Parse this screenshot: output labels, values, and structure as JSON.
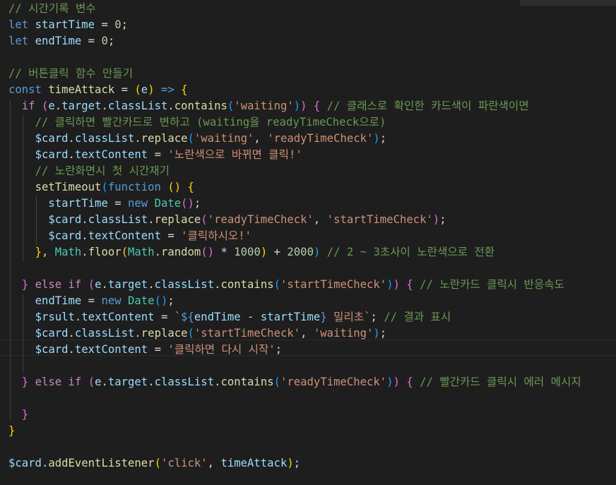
{
  "editor": {
    "theme_colors": {
      "background": "#1e1e1e",
      "comment": "#6a9955",
      "keyword": "#569cd6",
      "control": "#c586c0",
      "variable": "#9cdcfe",
      "function": "#dcdcaa",
      "string": "#ce9178",
      "number": "#b5cea8",
      "class": "#4ec9b0"
    },
    "lines": [
      {
        "tokens": [
          {
            "t": "// 시간기록 변수",
            "c": "comment"
          }
        ]
      },
      {
        "tokens": [
          {
            "t": "let",
            "c": "kw"
          },
          {
            "t": " ",
            "c": "op"
          },
          {
            "t": "startTime",
            "c": "var"
          },
          {
            "t": " = ",
            "c": "op"
          },
          {
            "t": "0",
            "c": "num"
          },
          {
            "t": ";",
            "c": "op"
          }
        ]
      },
      {
        "tokens": [
          {
            "t": "let",
            "c": "kw"
          },
          {
            "t": " ",
            "c": "op"
          },
          {
            "t": "endTime",
            "c": "var"
          },
          {
            "t": " = ",
            "c": "op"
          },
          {
            "t": "0",
            "c": "num"
          },
          {
            "t": ";",
            "c": "op"
          }
        ]
      },
      {
        "tokens": []
      },
      {
        "tokens": [
          {
            "t": "// 버튼클릭 함수 만들기",
            "c": "comment"
          }
        ]
      },
      {
        "tokens": [
          {
            "t": "const",
            "c": "kw"
          },
          {
            "t": " ",
            "c": "op"
          },
          {
            "t": "timeAttack",
            "c": "fn"
          },
          {
            "t": " = ",
            "c": "op"
          },
          {
            "t": "(",
            "c": "b1"
          },
          {
            "t": "e",
            "c": "var"
          },
          {
            "t": ")",
            "c": "b1"
          },
          {
            "t": " ",
            "c": "op"
          },
          {
            "t": "=>",
            "c": "kw"
          },
          {
            "t": " ",
            "c": "op"
          },
          {
            "t": "{",
            "c": "b1"
          }
        ]
      },
      {
        "tokens": [
          {
            "t": "  ",
            "c": "op"
          },
          {
            "t": "if",
            "c": "ctl"
          },
          {
            "t": " ",
            "c": "op"
          },
          {
            "t": "(",
            "c": "b2"
          },
          {
            "t": "e",
            "c": "var"
          },
          {
            "t": ".",
            "c": "op"
          },
          {
            "t": "target",
            "c": "var"
          },
          {
            "t": ".",
            "c": "op"
          },
          {
            "t": "classList",
            "c": "var"
          },
          {
            "t": ".",
            "c": "op"
          },
          {
            "t": "contains",
            "c": "fn"
          },
          {
            "t": "(",
            "c": "b3"
          },
          {
            "t": "'waiting'",
            "c": "str"
          },
          {
            "t": ")",
            "c": "b3"
          },
          {
            "t": ")",
            "c": "b2"
          },
          {
            "t": " ",
            "c": "op"
          },
          {
            "t": "{",
            "c": "b2"
          },
          {
            "t": " ",
            "c": "op"
          },
          {
            "t": "// 클래스로 확인한 카드색이 파란색이면",
            "c": "comment"
          }
        ]
      },
      {
        "tokens": [
          {
            "t": "    ",
            "c": "op"
          },
          {
            "t": "// 클릭하면 빨간카드로 변하고 (waiting을 readyTimeCheck으로)",
            "c": "comment"
          }
        ]
      },
      {
        "tokens": [
          {
            "t": "    ",
            "c": "op"
          },
          {
            "t": "$card",
            "c": "var"
          },
          {
            "t": ".",
            "c": "op"
          },
          {
            "t": "classList",
            "c": "var"
          },
          {
            "t": ".",
            "c": "op"
          },
          {
            "t": "replace",
            "c": "fn"
          },
          {
            "t": "(",
            "c": "b3"
          },
          {
            "t": "'waiting'",
            "c": "str"
          },
          {
            "t": ", ",
            "c": "op"
          },
          {
            "t": "'readyTimeCheck'",
            "c": "str"
          },
          {
            "t": ")",
            "c": "b3"
          },
          {
            "t": ";",
            "c": "op"
          }
        ]
      },
      {
        "tokens": [
          {
            "t": "    ",
            "c": "op"
          },
          {
            "t": "$card",
            "c": "var"
          },
          {
            "t": ".",
            "c": "op"
          },
          {
            "t": "textContent",
            "c": "var"
          },
          {
            "t": " = ",
            "c": "op"
          },
          {
            "t": "'노란색으로 바뀌면 클릭!'",
            "c": "str"
          }
        ]
      },
      {
        "tokens": [
          {
            "t": "    ",
            "c": "op"
          },
          {
            "t": "// 노란화면시 첫 시간재기",
            "c": "comment"
          }
        ]
      },
      {
        "tokens": [
          {
            "t": "    ",
            "c": "op"
          },
          {
            "t": "setTimeout",
            "c": "fn"
          },
          {
            "t": "(",
            "c": "b3"
          },
          {
            "t": "function",
            "c": "kw"
          },
          {
            "t": " ",
            "c": "op"
          },
          {
            "t": "()",
            "c": "b1"
          },
          {
            "t": " ",
            "c": "op"
          },
          {
            "t": "{",
            "c": "b1"
          }
        ]
      },
      {
        "tokens": [
          {
            "t": "      ",
            "c": "op"
          },
          {
            "t": "startTime",
            "c": "var"
          },
          {
            "t": " = ",
            "c": "op"
          },
          {
            "t": "new",
            "c": "kw"
          },
          {
            "t": " ",
            "c": "op"
          },
          {
            "t": "Date",
            "c": "cls"
          },
          {
            "t": "()",
            "c": "b2"
          },
          {
            "t": ";",
            "c": "op"
          }
        ]
      },
      {
        "tokens": [
          {
            "t": "      ",
            "c": "op"
          },
          {
            "t": "$card",
            "c": "var"
          },
          {
            "t": ".",
            "c": "op"
          },
          {
            "t": "classList",
            "c": "var"
          },
          {
            "t": ".",
            "c": "op"
          },
          {
            "t": "replace",
            "c": "fn"
          },
          {
            "t": "(",
            "c": "b2"
          },
          {
            "t": "'readyTimeCheck'",
            "c": "str"
          },
          {
            "t": ", ",
            "c": "op"
          },
          {
            "t": "'startTimeCheck'",
            "c": "str"
          },
          {
            "t": ")",
            "c": "b2"
          },
          {
            "t": ";",
            "c": "op"
          }
        ]
      },
      {
        "tokens": [
          {
            "t": "      ",
            "c": "op"
          },
          {
            "t": "$card",
            "c": "var"
          },
          {
            "t": ".",
            "c": "op"
          },
          {
            "t": "textContent",
            "c": "var"
          },
          {
            "t": " = ",
            "c": "op"
          },
          {
            "t": "'클릭하시오!'",
            "c": "str"
          }
        ]
      },
      {
        "tokens": [
          {
            "t": "    ",
            "c": "op"
          },
          {
            "t": "}",
            "c": "b1"
          },
          {
            "t": ", ",
            "c": "op"
          },
          {
            "t": "Math",
            "c": "cls"
          },
          {
            "t": ".",
            "c": "op"
          },
          {
            "t": "floor",
            "c": "fn"
          },
          {
            "t": "(",
            "c": "b1"
          },
          {
            "t": "Math",
            "c": "cls"
          },
          {
            "t": ".",
            "c": "op"
          },
          {
            "t": "random",
            "c": "fn"
          },
          {
            "t": "()",
            "c": "b2"
          },
          {
            "t": " * ",
            "c": "op"
          },
          {
            "t": "1000",
            "c": "num"
          },
          {
            "t": ")",
            "c": "b1"
          },
          {
            "t": " + ",
            "c": "op"
          },
          {
            "t": "2000",
            "c": "num"
          },
          {
            "t": ")",
            "c": "b3"
          },
          {
            "t": " ",
            "c": "op"
          },
          {
            "t": "// 2 ~ 3초사이 노란색으로 전환",
            "c": "comment"
          }
        ]
      },
      {
        "tokens": []
      },
      {
        "tokens": [
          {
            "t": "  ",
            "c": "op"
          },
          {
            "t": "}",
            "c": "b2"
          },
          {
            "t": " ",
            "c": "op"
          },
          {
            "t": "else",
            "c": "ctl"
          },
          {
            "t": " ",
            "c": "op"
          },
          {
            "t": "if",
            "c": "ctl"
          },
          {
            "t": " ",
            "c": "op"
          },
          {
            "t": "(",
            "c": "b2"
          },
          {
            "t": "e",
            "c": "var"
          },
          {
            "t": ".",
            "c": "op"
          },
          {
            "t": "target",
            "c": "var"
          },
          {
            "t": ".",
            "c": "op"
          },
          {
            "t": "classList",
            "c": "var"
          },
          {
            "t": ".",
            "c": "op"
          },
          {
            "t": "contains",
            "c": "fn"
          },
          {
            "t": "(",
            "c": "b3"
          },
          {
            "t": "'startTimeCheck'",
            "c": "str"
          },
          {
            "t": ")",
            "c": "b3"
          },
          {
            "t": ")",
            "c": "b2"
          },
          {
            "t": " ",
            "c": "op"
          },
          {
            "t": "{",
            "c": "b2"
          },
          {
            "t": " ",
            "c": "op"
          },
          {
            "t": "// 노란카드 클릭시 반응속도",
            "c": "comment"
          }
        ]
      },
      {
        "tokens": [
          {
            "t": "    ",
            "c": "op"
          },
          {
            "t": "endTime",
            "c": "var"
          },
          {
            "t": " = ",
            "c": "op"
          },
          {
            "t": "new",
            "c": "kw"
          },
          {
            "t": " ",
            "c": "op"
          },
          {
            "t": "Date",
            "c": "cls"
          },
          {
            "t": "()",
            "c": "b3"
          },
          {
            "t": ";",
            "c": "op"
          }
        ]
      },
      {
        "tokens": [
          {
            "t": "    ",
            "c": "op"
          },
          {
            "t": "$rsult",
            "c": "var"
          },
          {
            "t": ".",
            "c": "op"
          },
          {
            "t": "textContent",
            "c": "var"
          },
          {
            "t": " = ",
            "c": "op"
          },
          {
            "t": "`",
            "c": "str"
          },
          {
            "t": "${",
            "c": "kw"
          },
          {
            "t": "endTime",
            "c": "var"
          },
          {
            "t": " - ",
            "c": "op"
          },
          {
            "t": "startTime",
            "c": "var"
          },
          {
            "t": "}",
            "c": "kw"
          },
          {
            "t": " 밀리초`",
            "c": "str"
          },
          {
            "t": "; ",
            "c": "op"
          },
          {
            "t": "// 결과 표시",
            "c": "comment"
          }
        ]
      },
      {
        "tokens": [
          {
            "t": "    ",
            "c": "op"
          },
          {
            "t": "$card",
            "c": "var"
          },
          {
            "t": ".",
            "c": "op"
          },
          {
            "t": "classList",
            "c": "var"
          },
          {
            "t": ".",
            "c": "op"
          },
          {
            "t": "replace",
            "c": "fn"
          },
          {
            "t": "(",
            "c": "b3"
          },
          {
            "t": "'startTimeCheck'",
            "c": "str"
          },
          {
            "t": ", ",
            "c": "op"
          },
          {
            "t": "'waiting'",
            "c": "str"
          },
          {
            "t": ")",
            "c": "b3"
          },
          {
            "t": ";",
            "c": "op"
          }
        ]
      },
      {
        "tokens": [
          {
            "t": "    ",
            "c": "op"
          },
          {
            "t": "$card",
            "c": "var"
          },
          {
            "t": ".",
            "c": "op"
          },
          {
            "t": "textContent",
            "c": "var"
          },
          {
            "t": " = ",
            "c": "op"
          },
          {
            "t": "'클릭하면 다시 시작'",
            "c": "str"
          },
          {
            "t": ";",
            "c": "op"
          }
        ]
      },
      {
        "tokens": []
      },
      {
        "tokens": [
          {
            "t": "  ",
            "c": "op"
          },
          {
            "t": "}",
            "c": "b2"
          },
          {
            "t": " ",
            "c": "op"
          },
          {
            "t": "else",
            "c": "ctl"
          },
          {
            "t": " ",
            "c": "op"
          },
          {
            "t": "if",
            "c": "ctl"
          },
          {
            "t": " ",
            "c": "op"
          },
          {
            "t": "(",
            "c": "b2"
          },
          {
            "t": "e",
            "c": "var"
          },
          {
            "t": ".",
            "c": "op"
          },
          {
            "t": "target",
            "c": "var"
          },
          {
            "t": ".",
            "c": "op"
          },
          {
            "t": "classList",
            "c": "var"
          },
          {
            "t": ".",
            "c": "op"
          },
          {
            "t": "contains",
            "c": "fn"
          },
          {
            "t": "(",
            "c": "b3"
          },
          {
            "t": "'readyTimeCheck'",
            "c": "str"
          },
          {
            "t": ")",
            "c": "b3"
          },
          {
            "t": ")",
            "c": "b2"
          },
          {
            "t": " ",
            "c": "op"
          },
          {
            "t": "{",
            "c": "b2"
          },
          {
            "t": " ",
            "c": "op"
          },
          {
            "t": "// 빨간카드 클릭시 에러 메시지",
            "c": "comment"
          }
        ]
      },
      {
        "tokens": []
      },
      {
        "tokens": [
          {
            "t": "  ",
            "c": "op"
          },
          {
            "t": "}",
            "c": "b2"
          }
        ]
      },
      {
        "tokens": [
          {
            "t": "}",
            "c": "b1"
          }
        ]
      },
      {
        "tokens": []
      },
      {
        "tokens": [
          {
            "t": "$card",
            "c": "var"
          },
          {
            "t": ".",
            "c": "op"
          },
          {
            "t": "addEventListener",
            "c": "fn"
          },
          {
            "t": "(",
            "c": "b1"
          },
          {
            "t": "'click'",
            "c": "str"
          },
          {
            "t": ", ",
            "c": "op"
          },
          {
            "t": "timeAttack",
            "c": "var"
          },
          {
            "t": ")",
            "c": "b1"
          },
          {
            "t": ";",
            "c": "op"
          }
        ]
      }
    ]
  }
}
